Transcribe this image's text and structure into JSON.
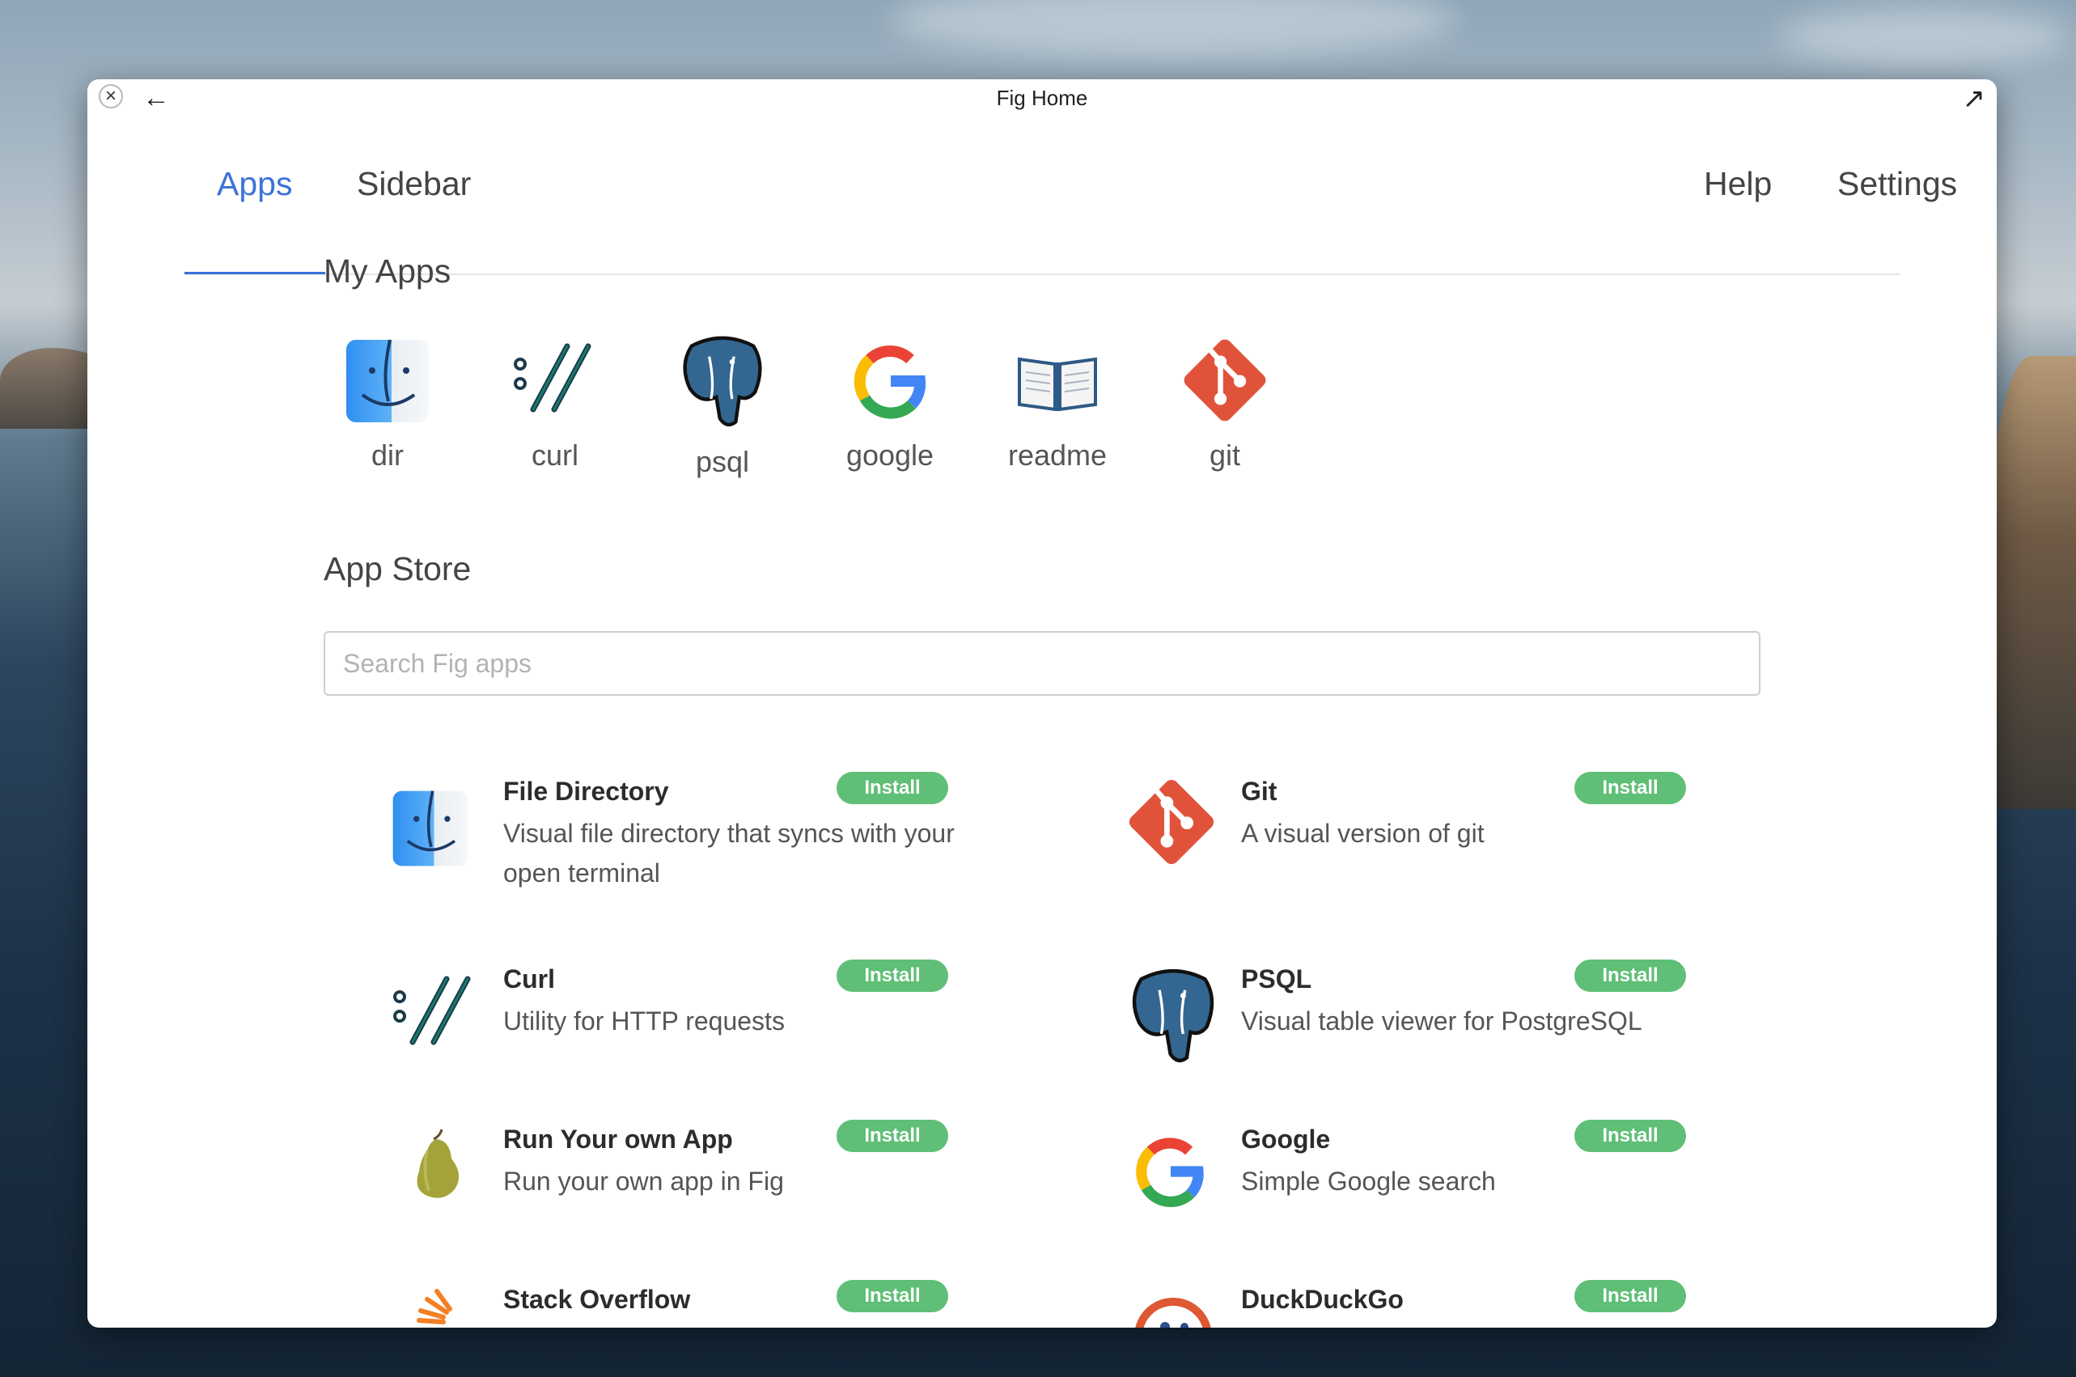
{
  "window": {
    "title": "Fig Home"
  },
  "tabs": [
    {
      "label": "Apps",
      "active": true
    },
    {
      "label": "Sidebar",
      "active": false
    },
    {
      "label": "Help",
      "active": false
    },
    {
      "label": "Settings",
      "active": false
    }
  ],
  "my_apps": {
    "title": "My Apps",
    "items": [
      {
        "label": "dir",
        "icon": "finder-icon"
      },
      {
        "label": "curl",
        "icon": "curl-icon"
      },
      {
        "label": "psql",
        "icon": "postgresql-elephant-icon"
      },
      {
        "label": "google",
        "icon": "google-icon"
      },
      {
        "label": "readme",
        "icon": "open-book-icon"
      },
      {
        "label": "git",
        "icon": "git-icon"
      }
    ]
  },
  "app_store": {
    "title": "App Store",
    "search_placeholder": "Search Fig apps",
    "apps": [
      {
        "name": "File Directory",
        "description": "Visual file directory that syncs with your open terminal",
        "button": "Install",
        "icon": "finder-icon"
      },
      {
        "name": "Git",
        "description": "A visual version of git",
        "button": "Install",
        "icon": "git-icon"
      },
      {
        "name": "Curl",
        "description": "Utility for HTTP requests",
        "button": "Install",
        "icon": "curl-icon"
      },
      {
        "name": "PSQL",
        "description": "Visual table viewer for PostgreSQL",
        "button": "Install",
        "icon": "postgresql-elephant-icon"
      },
      {
        "name": "Run Your own App",
        "description": "Run your own app in Fig",
        "button": "Install",
        "icon": "pear-icon"
      },
      {
        "name": "Google",
        "description": "Simple Google search",
        "button": "Install",
        "icon": "google-icon"
      },
      {
        "name": "Stack Overflow",
        "description": "",
        "button": "Install",
        "icon": "stack-overflow-icon"
      },
      {
        "name": "DuckDuckGo",
        "description": "",
        "button": "Install",
        "icon": "duckduckgo-icon"
      }
    ]
  },
  "colors": {
    "accent": "#3b73d9",
    "install": "#5fbf76",
    "git": "#e0533a",
    "postgres": "#336791"
  }
}
